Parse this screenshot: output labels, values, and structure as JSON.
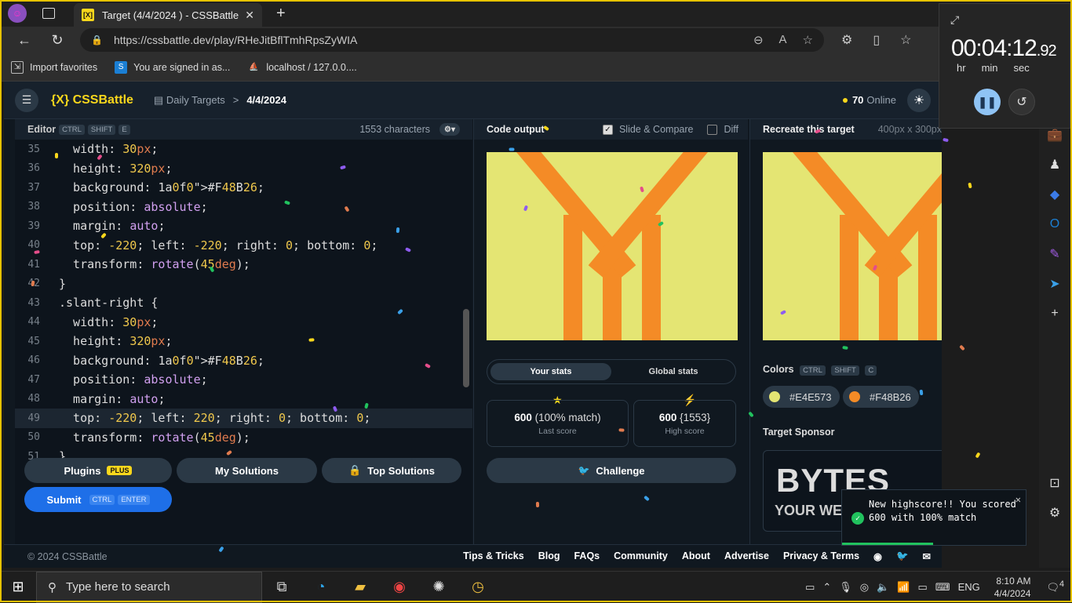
{
  "browser": {
    "tab_title": "Target (4/4/2024 ) - CSSBattle",
    "tab_favicon": "[X]",
    "url": "https://cssbattle.dev/play/RHeJitBflTmhRpsZyWIA",
    "favorites": [
      {
        "label": "Import favorites",
        "icon": "import-icon"
      },
      {
        "label": "You are signed in as...",
        "icon": "s-icon"
      },
      {
        "label": "localhost / 127.0.0....",
        "icon": "phpmyadmin-icon"
      }
    ]
  },
  "timer": {
    "time": "00:04:12",
    "fraction": ".92",
    "units": [
      "hr",
      "min",
      "sec"
    ]
  },
  "header": {
    "logo": "{X} CSSBattle",
    "crumb": "Daily Targets",
    "crumb_sep": ">",
    "date": "4/4/2024",
    "online_count": "70",
    "online_label": "Online"
  },
  "editor": {
    "title": "Editor",
    "shortcut": [
      "CTRL",
      "SHIFT",
      "E"
    ],
    "characters": "1553 characters",
    "lines": [
      {
        "n": "35",
        "code": "  width: 30px;"
      },
      {
        "n": "36",
        "code": "  height: 320px;"
      },
      {
        "n": "37",
        "code": "  background: #F48B26;"
      },
      {
        "n": "38",
        "code": "  position: absolute;"
      },
      {
        "n": "39",
        "code": "  margin: auto;"
      },
      {
        "n": "40",
        "code": "  top: -220; left: -220; right: 0; bottom: 0;"
      },
      {
        "n": "41",
        "code": "  transform: rotate(45deg);"
      },
      {
        "n": "42",
        "code": "}"
      },
      {
        "n": "43",
        "code": ".slant-right {"
      },
      {
        "n": "44",
        "code": "  width: 30px;"
      },
      {
        "n": "45",
        "code": "  height: 320px;"
      },
      {
        "n": "46",
        "code": "  background: #F48B26;"
      },
      {
        "n": "47",
        "code": "  position: absolute;"
      },
      {
        "n": "48",
        "code": "  margin: auto;"
      },
      {
        "n": "49",
        "code": "  top: -220; left: 220; right: 0; bottom: 0;"
      },
      {
        "n": "50",
        "code": "  transform: rotate(45deg);"
      },
      {
        "n": "51",
        "code": "}"
      }
    ],
    "active_line": "49",
    "plugins_label": "Plugins",
    "plugins_badge": "PLUS",
    "solutions_label": "My Solutions",
    "top_solutions_label": "Top Solutions",
    "submit_label": "Submit",
    "submit_keys": [
      "CTRL",
      "ENTER"
    ]
  },
  "output": {
    "title": "Code output",
    "slide_compare": "Slide & Compare",
    "diff": "Diff",
    "your_stats": "Your stats",
    "global_stats": "Global stats",
    "last_score": "600",
    "last_match": "(100% match)",
    "last_label": "Last score",
    "high_score": "600",
    "high_chars": "{1553}",
    "high_label": "High score",
    "challenge": "Challenge"
  },
  "target": {
    "title": "Recreate this target",
    "dimensions": "400px x 300px",
    "colors_title": "Colors",
    "colors_keys": [
      "CTRL",
      "SHIFT",
      "C"
    ],
    "colors": [
      "#E4E573",
      "#F48B26"
    ],
    "sponsor_title": "Target Sponsor",
    "sponsor_logo": "BYTES",
    "sponsor_sub": "YOUR WEEK"
  },
  "toast": {
    "message": "New highscore!! You scored 600 with 100% match"
  },
  "footer": {
    "copyright": "© 2024 CSSBattle",
    "links": [
      "Tips & Tricks",
      "Blog",
      "FAQs",
      "Community",
      "About",
      "Advertise",
      "Privacy & Terms"
    ]
  },
  "taskbar": {
    "search_placeholder": "Type here to search",
    "lang": "ENG",
    "time": "8:10 AM",
    "date": "4/4/2024",
    "notifications": "4"
  },
  "colors": {
    "accent": "#f9d71c",
    "bg": "#E4E573",
    "fg": "#F48B26",
    "submit": "#1e6fe8"
  }
}
